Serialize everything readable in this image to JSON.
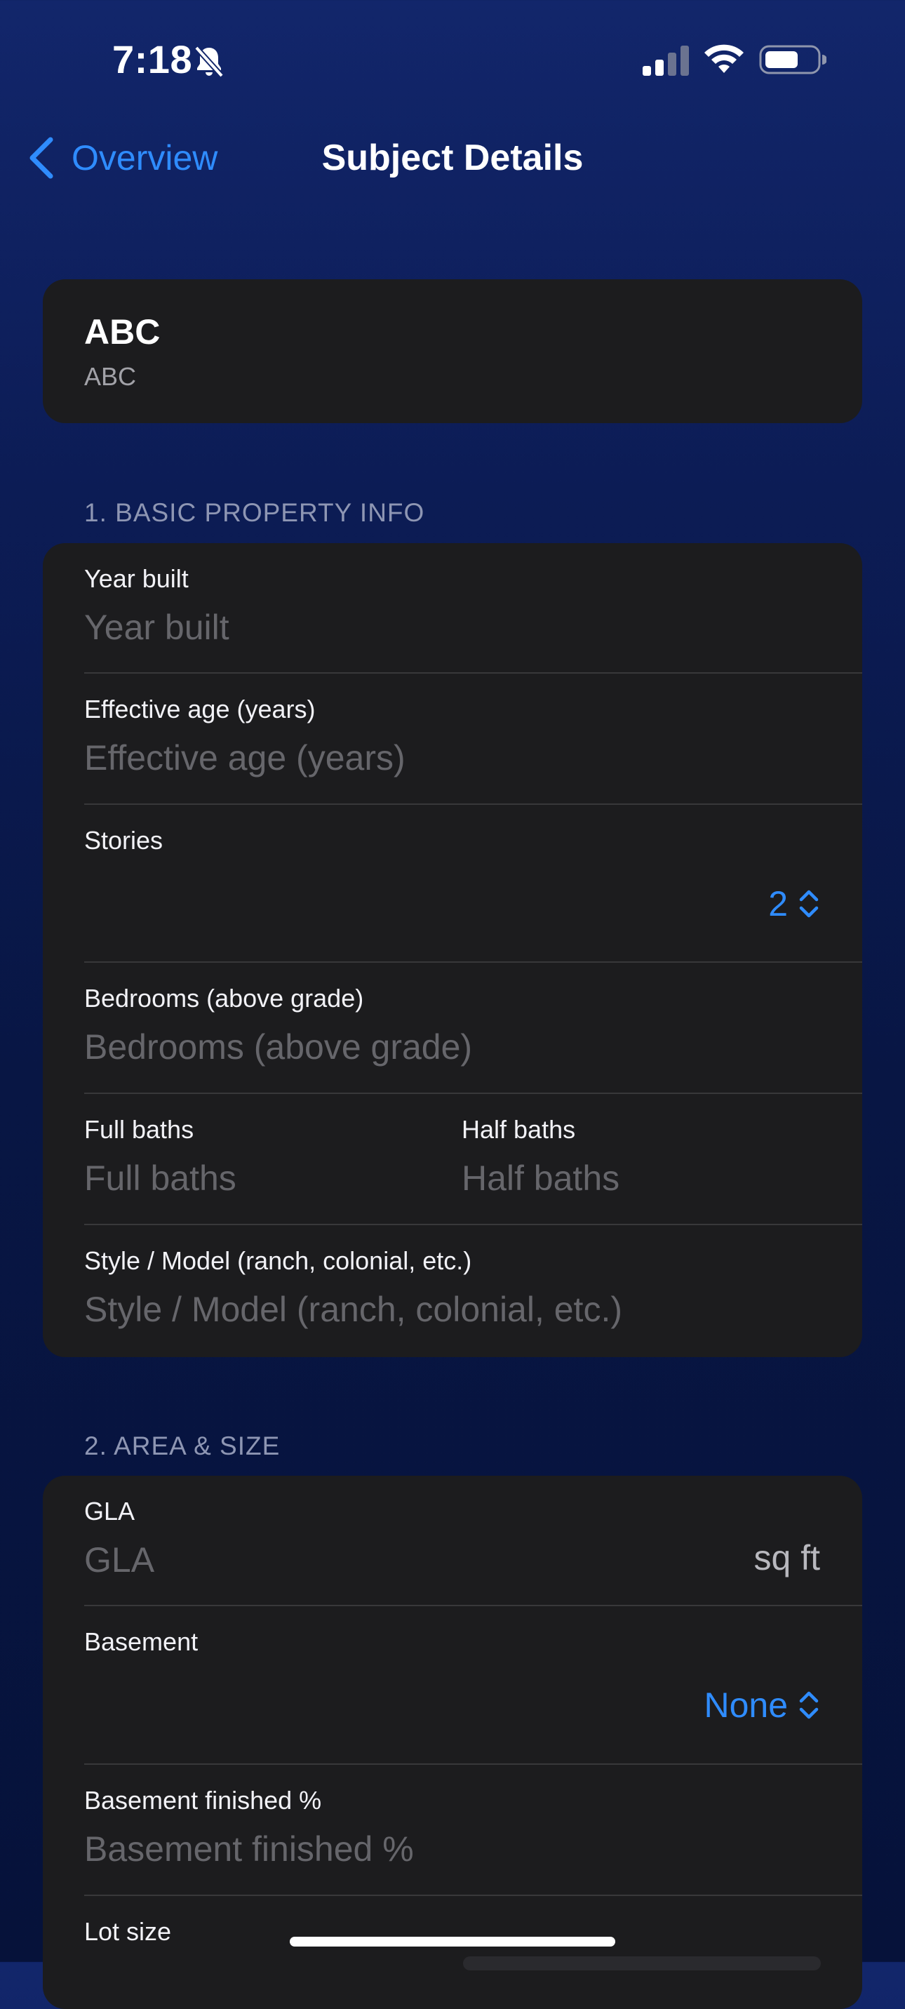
{
  "status_bar": {
    "time": "7:18"
  },
  "nav": {
    "back_label": "Overview",
    "title": "Subject Details"
  },
  "header_card": {
    "title": "ABC",
    "subtitle": "ABC"
  },
  "sections": {
    "basic": {
      "header": "1. BASIC PROPERTY INFO",
      "year_built": {
        "label": "Year built",
        "placeholder": "Year built"
      },
      "effective_age": {
        "label": "Effective age (years)",
        "placeholder": "Effective age (years)"
      },
      "stories": {
        "label": "Stories",
        "value": "2"
      },
      "bedrooms": {
        "label": "Bedrooms (above grade)",
        "placeholder": "Bedrooms (above grade)"
      },
      "full_baths": {
        "label": "Full baths",
        "placeholder": "Full baths"
      },
      "half_baths": {
        "label": "Half baths",
        "placeholder": "Half baths"
      },
      "style": {
        "label": "Style / Model (ranch, colonial, etc.)",
        "placeholder": "Style / Model (ranch, colonial, etc.)"
      }
    },
    "area": {
      "header": "2. AREA & SIZE",
      "gla": {
        "label": "GLA",
        "placeholder": "GLA",
        "unit": "sq ft"
      },
      "basement": {
        "label": "Basement",
        "value": "None"
      },
      "basement_finished": {
        "label": "Basement finished %",
        "placeholder": "Basement finished %"
      },
      "lot_size": {
        "label": "Lot size"
      }
    }
  },
  "colors": {
    "accent": "#2f8cff",
    "card": "#1c1c1e",
    "placeholder": "#66666b",
    "section_header": "#8e96b3"
  }
}
